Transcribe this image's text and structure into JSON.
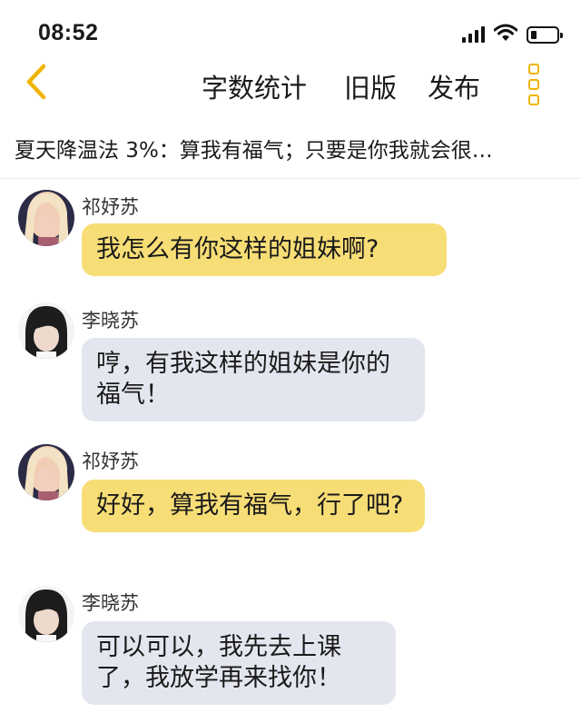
{
  "status_bar": {
    "time": "08:52",
    "icons": [
      "signal-icon",
      "wifi-icon",
      "battery-icon"
    ],
    "battery_level": 0.2
  },
  "nav": {
    "back_icon": "chevron-left-icon",
    "word_count_label": "字数统计",
    "old_version_label": "旧版",
    "publish_label": "发布",
    "more_icon": "more-vertical-icon",
    "accent_color": "#f0b400"
  },
  "story": {
    "title": "夏天降温法 3%：算我有福气；只要是你我就会很…"
  },
  "colors": {
    "bubble_yellow": "#f7dd76",
    "bubble_gray": "#e4e6ef"
  },
  "messages": [
    {
      "sender": "祁妤苏",
      "text": "我怎么有你这样的姐妹啊?"
    },
    {
      "sender": "李晓苏",
      "text": "哼，有我这样的姐妹是你的福气！"
    },
    {
      "sender": "祁妤苏",
      "text": "好好，算我有福气，行了吧?"
    },
    {
      "sender": "李晓苏",
      "text": "可以可以，我先去上课了，我放学再来找你！"
    }
  ]
}
